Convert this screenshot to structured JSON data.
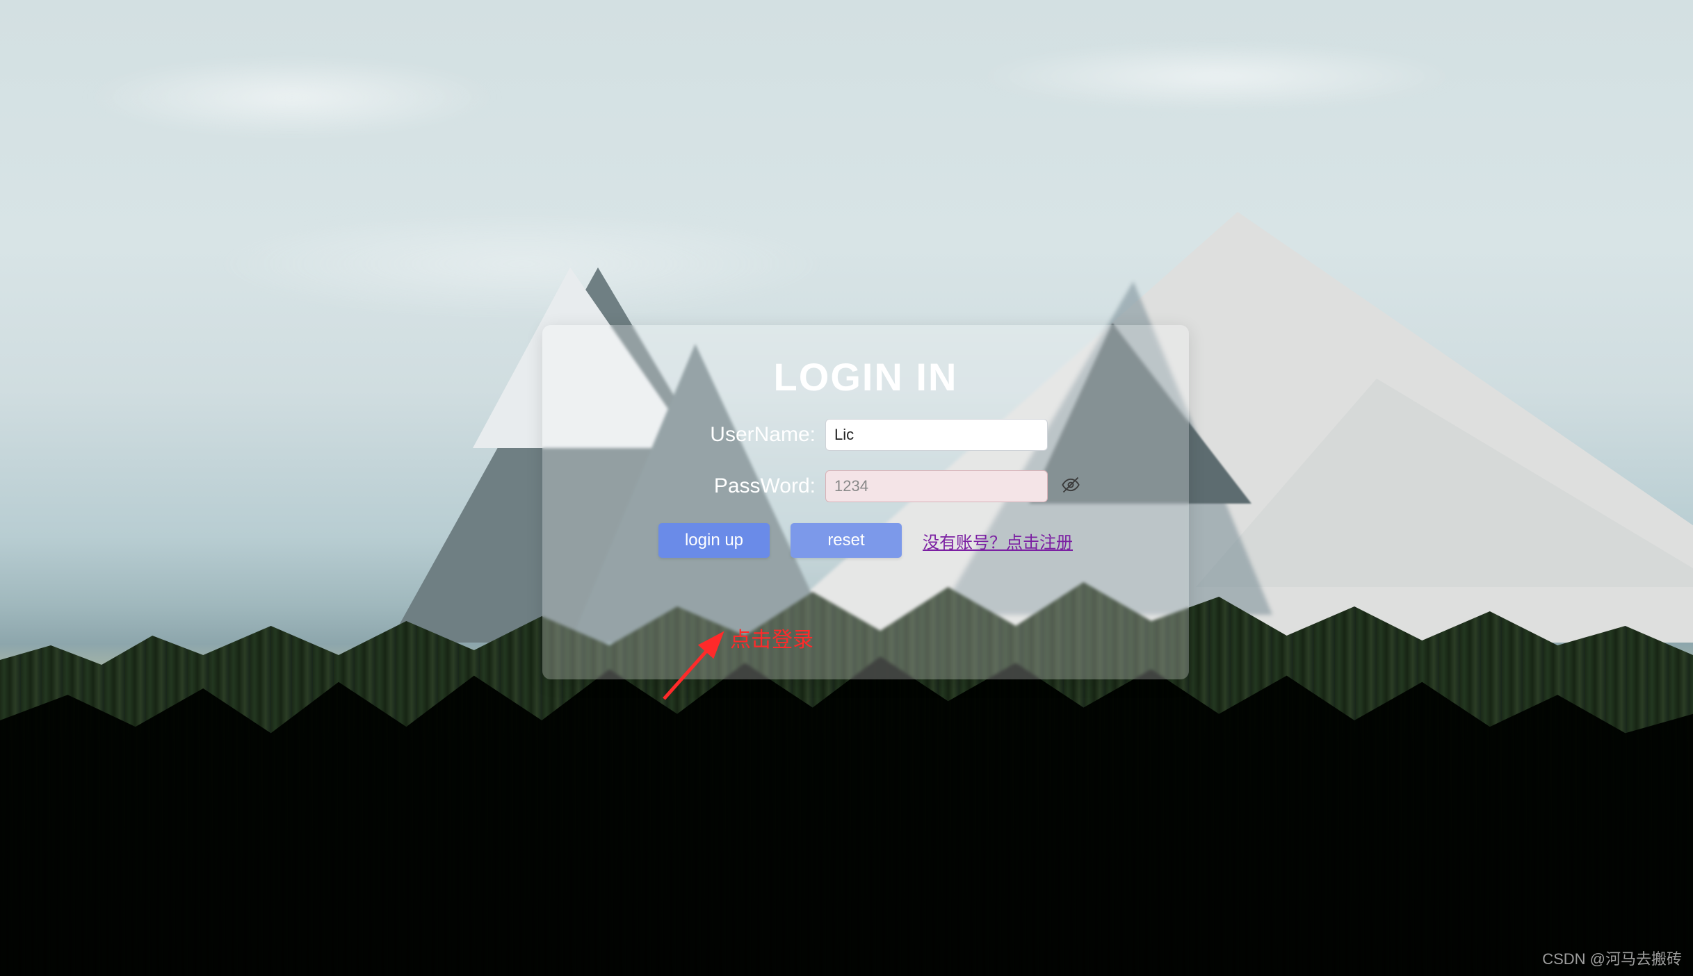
{
  "form": {
    "title": "LOGIN IN",
    "username_label": "UserName:",
    "username_value": "Lic",
    "password_label": "PassWord:",
    "password_value": "1234",
    "login_button": "login up",
    "reset_button": "reset",
    "register_link": "没有账号？点击注册"
  },
  "annotation": {
    "text": "点击登录"
  },
  "watermark": "CSDN @河马去搬砖",
  "icons": {
    "eye_off": "eye-off-icon"
  },
  "colors": {
    "button_primary": "#6a8be8",
    "link": "#7b1fa2",
    "annotation": "#ff2a2a"
  }
}
